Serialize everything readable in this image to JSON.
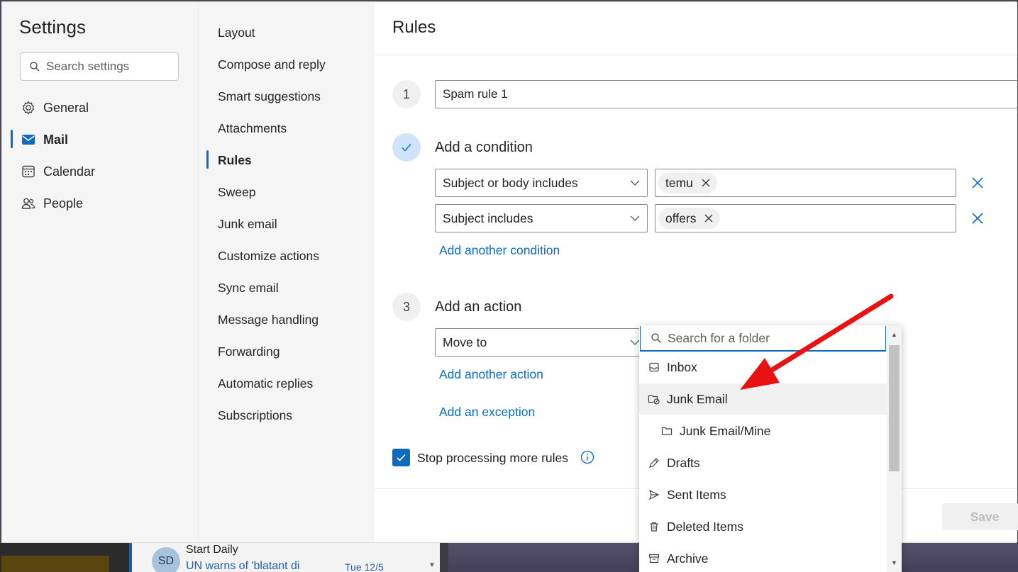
{
  "background": {
    "message": {
      "avatar_initials": "SD",
      "sender": "Start Daily",
      "subject": "UN warns of 'blatant di",
      "date": "Tue 12/5"
    }
  },
  "settings": {
    "title": "Settings",
    "search_placeholder": "Search settings",
    "categories": [
      {
        "label": "General",
        "icon": "gear-icon"
      },
      {
        "label": "Mail",
        "icon": "mail-icon",
        "active": true
      },
      {
        "label": "Calendar",
        "icon": "calendar-icon"
      },
      {
        "label": "People",
        "icon": "people-icon"
      }
    ],
    "mail_sections": [
      "Layout",
      "Compose and reply",
      "Smart suggestions",
      "Attachments",
      "Rules",
      "Sweep",
      "Junk email",
      "Customize actions",
      "Sync email",
      "Message handling",
      "Forwarding",
      "Automatic replies",
      "Subscriptions"
    ],
    "active_section": "Rules"
  },
  "rules": {
    "title": "Rules",
    "step1_number": "1",
    "rule_name": "Spam rule 1",
    "step2_title": "Add a condition",
    "conditions": [
      {
        "type": "Subject or body includes",
        "tag": "temu"
      },
      {
        "type": "Subject includes",
        "tag": "offers"
      }
    ],
    "add_condition_label": "Add another condition",
    "step3_number": "3",
    "step3_title": "Add an action",
    "action_type": "Move to",
    "add_action_label": "Add another action",
    "add_exception_label": "Add an exception",
    "stop_processing_label": "Stop processing more rules",
    "stop_processing_checked": true,
    "save_label": "Save"
  },
  "folder_picker": {
    "search_placeholder": "Search for a folder",
    "folders": [
      {
        "label": "Inbox",
        "icon": "inbox-icon"
      },
      {
        "label": "Junk Email",
        "icon": "junk-folder-icon",
        "highlighted": true
      },
      {
        "label": "Junk Email/Mine",
        "icon": "folder-icon",
        "indent": true
      },
      {
        "label": "Drafts",
        "icon": "pencil-icon"
      },
      {
        "label": "Sent Items",
        "icon": "send-icon"
      },
      {
        "label": "Deleted Items",
        "icon": "trash-icon"
      },
      {
        "label": "Archive",
        "icon": "archive-icon"
      }
    ]
  },
  "colors": {
    "accent": "#0f6cbd",
    "annotation_arrow": "#e81212"
  }
}
